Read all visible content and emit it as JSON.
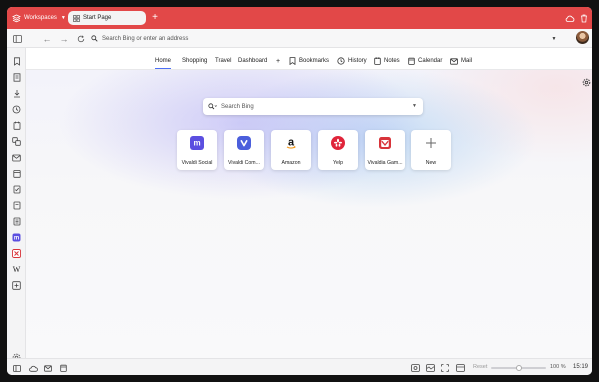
{
  "titlebar": {
    "workspaces_label": "Workspaces",
    "active_tab": "Start Page",
    "color": "#e24848"
  },
  "address_bar": {
    "placeholder": "Search Bing or enter an address"
  },
  "nav": {
    "items": [
      "Home",
      "Shopping",
      "Travel",
      "Dashboard",
      "+"
    ],
    "bookmarks": "Bookmarks",
    "history": "History",
    "notes": "Notes",
    "calendar": "Calendar",
    "mail": "Mail",
    "active": "Home"
  },
  "search": {
    "placeholder": "Search Bing"
  },
  "speed_dials": [
    {
      "label": "Vivaldi Social",
      "icon": "mastodon-icon",
      "color": "#5b4fe0"
    },
    {
      "label": "Vivaldi Com...",
      "icon": "vivaldi-icon",
      "color": "#4b5fdc"
    },
    {
      "label": "Amazon",
      "icon": "amazon-icon",
      "color": "#111111"
    },
    {
      "label": "Yelp",
      "icon": "yelp-icon",
      "color": "#e0243a"
    },
    {
      "label": "Vivaldia Gam...",
      "icon": "vivaldia-games-icon",
      "color": "#d8343a"
    },
    {
      "label": "New",
      "icon": "plus-icon",
      "color": "#666666"
    }
  ],
  "status_bar": {
    "reset_label": "Reset",
    "zoom": "100 %",
    "zoom_level": 1.0,
    "time": "15:19"
  }
}
